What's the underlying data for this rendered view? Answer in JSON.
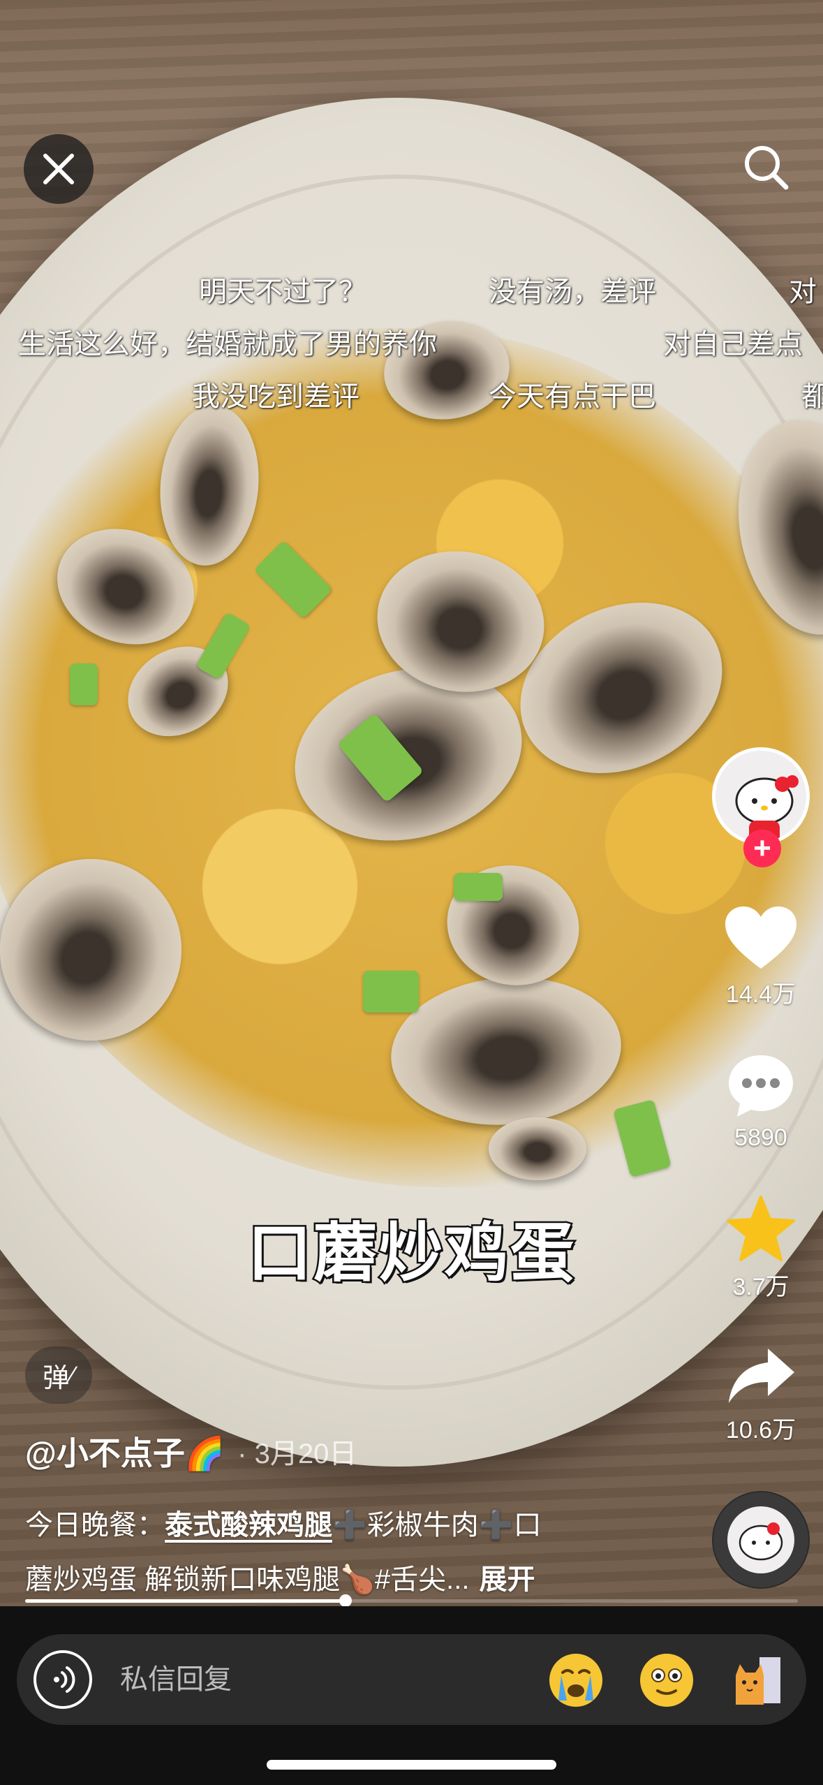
{
  "danmaku": {
    "row1": [
      "明天不过了？",
      "没有汤，差评",
      "对"
    ],
    "row2": [
      "生活这么好，结婚就成了男的养你",
      "对自己差点"
    ],
    "row3": [
      "我没吃到差评",
      "今天有点干巴",
      "都"
    ]
  },
  "video": {
    "caption": "口蘑炒鸡蛋"
  },
  "actions": {
    "like_count": "14.4万",
    "comment_count": "5890",
    "favorite_count": "3.7万",
    "share_count": "10.6万"
  },
  "colors": {
    "follow_red": "#fe2c55",
    "star_yellow": "#f8c21a"
  },
  "danmu_toggle_label": "弹",
  "post": {
    "author": "@小不点子🌈",
    "date": "· 3月20日",
    "desc_prefix": "今日晚餐：",
    "desc_link": "泰式酸辣鸡腿",
    "desc_mid1": "➕彩椒牛肉➕口",
    "desc_line2": "蘑炒鸡蛋 解锁新口味鸡腿🍗#舌尖...",
    "expand": "展开"
  },
  "progress": {
    "fraction": 0.415
  },
  "reply": {
    "placeholder": "私信回复",
    "emoji1": "😭",
    "emoji2": "🙂",
    "emoji3": "🐱"
  },
  "icons": [
    "close-icon",
    "search-icon",
    "heart-icon",
    "comment-icon",
    "star-icon",
    "share-icon",
    "voice-icon"
  ]
}
